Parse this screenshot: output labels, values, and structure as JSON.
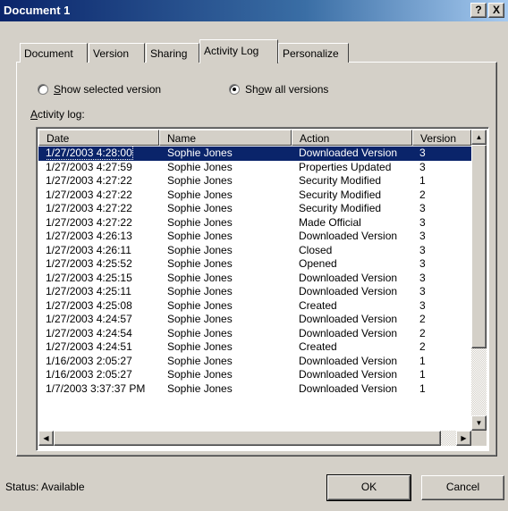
{
  "window": {
    "title": "Document 1",
    "help_label": "?",
    "close_label": "X"
  },
  "tabs": [
    {
      "label": "Document",
      "active": false
    },
    {
      "label": "Version",
      "active": false
    },
    {
      "label": "Sharing",
      "active": false
    },
    {
      "label": "Activity Log",
      "active": true
    },
    {
      "label": "Personalize",
      "active": false
    }
  ],
  "radios": {
    "selected_prefix": "S",
    "selected_rest": "how selected version",
    "all_prefix": "Sh",
    "all_underline": "o",
    "all_rest": "w all versions",
    "selected_checked": false,
    "all_checked": true
  },
  "log_label": {
    "underline": "A",
    "rest": "ctivity log:"
  },
  "columns": [
    "Date",
    "Name",
    "Action",
    "Version"
  ],
  "rows": [
    {
      "date": "1/27/2003 4:28:00",
      "name": "Sophie Jones",
      "action": "Downloaded Version",
      "version": "3"
    },
    {
      "date": "1/27/2003 4:27:59",
      "name": "Sophie Jones",
      "action": "Properties Updated",
      "version": "3"
    },
    {
      "date": "1/27/2003 4:27:22",
      "name": "Sophie Jones",
      "action": "Security Modified",
      "version": "1"
    },
    {
      "date": "1/27/2003 4:27:22",
      "name": "Sophie Jones",
      "action": "Security Modified",
      "version": "2"
    },
    {
      "date": "1/27/2003 4:27:22",
      "name": "Sophie Jones",
      "action": "Security Modified",
      "version": "3"
    },
    {
      "date": "1/27/2003 4:27:22",
      "name": "Sophie Jones",
      "action": "Made Official",
      "version": "3"
    },
    {
      "date": "1/27/2003 4:26:13",
      "name": "Sophie Jones",
      "action": "Downloaded Version",
      "version": "3"
    },
    {
      "date": "1/27/2003 4:26:11",
      "name": "Sophie Jones",
      "action": "Closed",
      "version": "3"
    },
    {
      "date": "1/27/2003 4:25:52",
      "name": "Sophie Jones",
      "action": "Opened",
      "version": "3"
    },
    {
      "date": "1/27/2003 4:25:15",
      "name": "Sophie Jones",
      "action": "Downloaded Version",
      "version": "3"
    },
    {
      "date": "1/27/2003 4:25:11",
      "name": "Sophie Jones",
      "action": "Downloaded Version",
      "version": "3"
    },
    {
      "date": "1/27/2003 4:25:08",
      "name": "Sophie Jones",
      "action": "Created",
      "version": "3"
    },
    {
      "date": "1/27/2003 4:24:57",
      "name": "Sophie Jones",
      "action": "Downloaded Version",
      "version": "2"
    },
    {
      "date": "1/27/2003 4:24:54",
      "name": "Sophie Jones",
      "action": "Downloaded Version",
      "version": "2"
    },
    {
      "date": "1/27/2003 4:24:51",
      "name": "Sophie Jones",
      "action": "Created",
      "version": "2"
    },
    {
      "date": "1/16/2003 2:05:27",
      "name": "Sophie Jones",
      "action": "Downloaded Version",
      "version": "1"
    },
    {
      "date": "1/16/2003 2:05:27",
      "name": "Sophie Jones",
      "action": "Downloaded Version",
      "version": "1"
    },
    {
      "date": "1/7/2003 3:37:37 PM",
      "name": "Sophie Jones",
      "action": "Downloaded Version",
      "version": "1"
    }
  ],
  "selected_row": 0,
  "status": "Status: Available",
  "buttons": {
    "ok": "OK",
    "cancel": "Cancel"
  },
  "colors": {
    "title_bar": "#0a246a",
    "selection": "#0a246a",
    "face": "#d4d0c8"
  }
}
